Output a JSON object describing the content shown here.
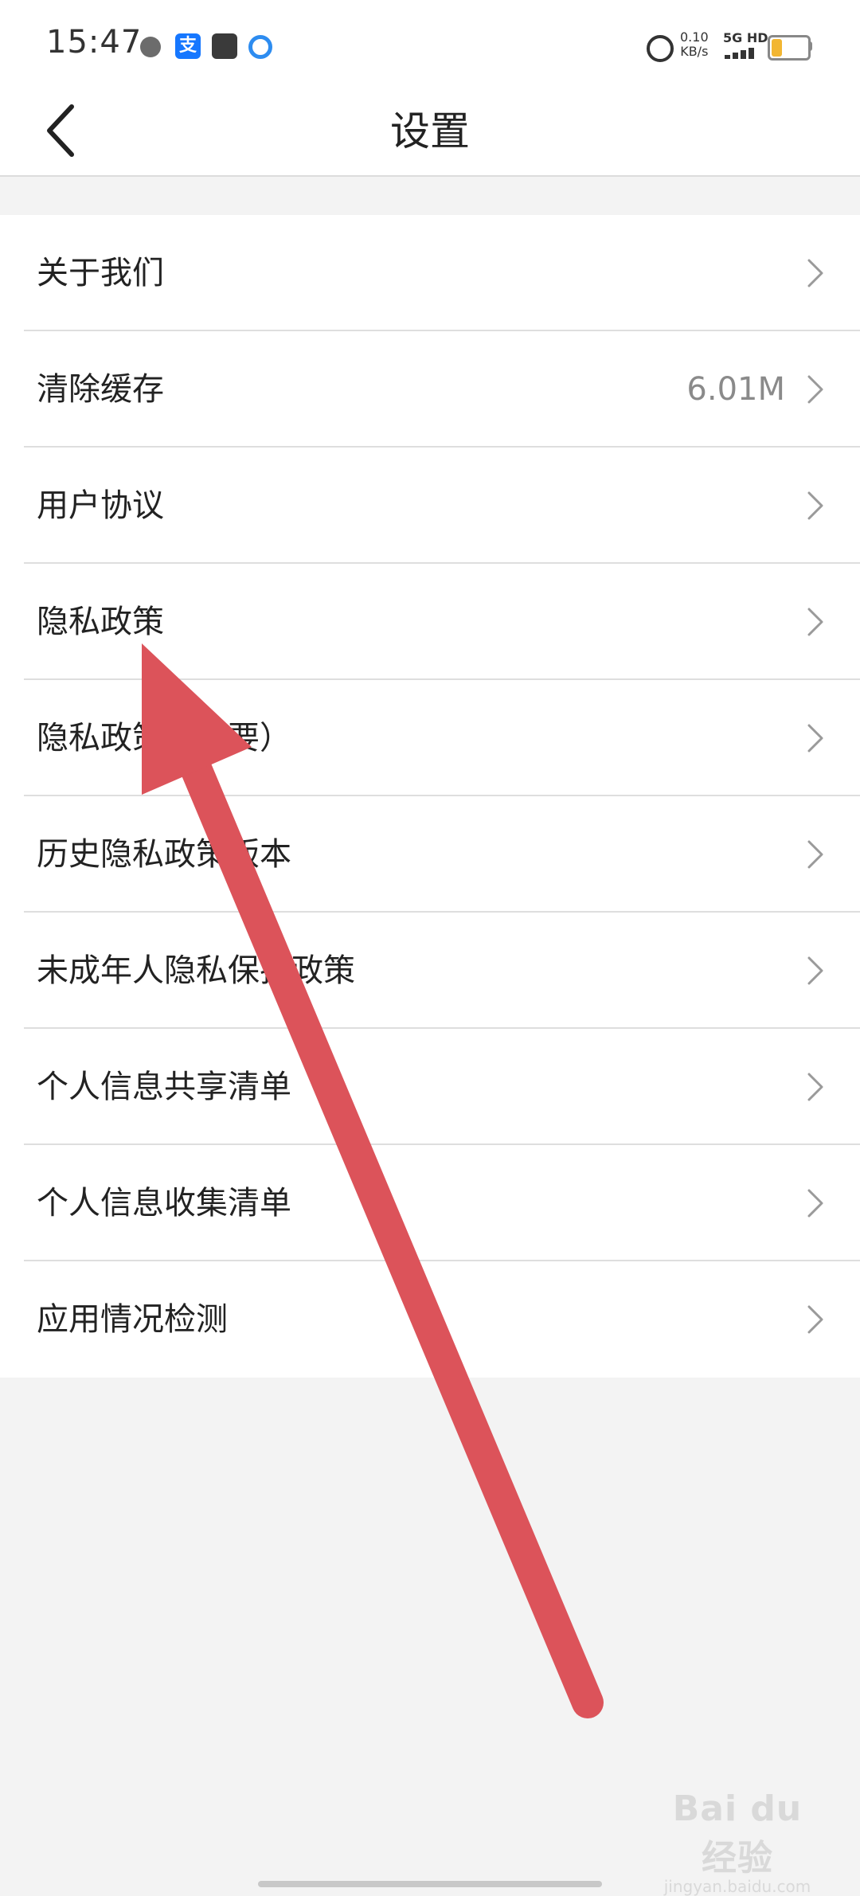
{
  "status_bar": {
    "time": "15:47",
    "net_speed_value": "0.10",
    "net_speed_unit": "KB/s",
    "network_type": "5G HD",
    "icons": [
      "app-icon",
      "alipay-icon",
      "shopping-icon",
      "browser-icon",
      "alarm-icon",
      "signal-icon",
      "battery-icon"
    ],
    "battery_level": 0.3
  },
  "header": {
    "title": "设置"
  },
  "settings": {
    "items": [
      {
        "label": "关于我们",
        "value": ""
      },
      {
        "label": "清除缓存",
        "value": "6.01M"
      },
      {
        "label": "用户协议",
        "value": ""
      },
      {
        "label": "隐私政策",
        "value": ""
      },
      {
        "label": "隐私政策（摘要）",
        "value": ""
      },
      {
        "label": "历史隐私政策版本",
        "value": ""
      },
      {
        "label": "未成年人隐私保护政策",
        "value": ""
      },
      {
        "label": "个人信息共享清单",
        "value": ""
      },
      {
        "label": "个人信息收集清单",
        "value": ""
      },
      {
        "label": "应用情况检测",
        "value": ""
      }
    ]
  },
  "annotation": {
    "color": "#dc535a"
  },
  "watermark": {
    "brand": "Bai du 经验",
    "sub": "jingyan.baidu.com"
  }
}
